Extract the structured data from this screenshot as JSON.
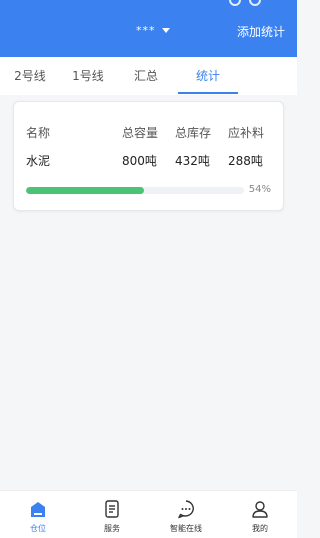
{
  "header": {
    "title": "***",
    "add_label": "添加统计"
  },
  "tabs": [
    {
      "label": "2号线"
    },
    {
      "label": "1号线"
    },
    {
      "label": "汇总"
    },
    {
      "label": "统计",
      "active": true
    }
  ],
  "card": {
    "columns": [
      "名称",
      "总容量",
      "总库存",
      "应补料"
    ],
    "row": {
      "name": "水泥",
      "capacity": "800吨",
      "stock": "432吨",
      "replenish": "288吨"
    },
    "progress": {
      "fraction": 0.54,
      "label": "54%"
    }
  },
  "bottom_nav": [
    {
      "label": "仓位",
      "icon": "warehouse-icon",
      "active": true
    },
    {
      "label": "服务",
      "icon": "document-icon"
    },
    {
      "label": "智能在线",
      "icon": "chat-icon"
    },
    {
      "label": "我的",
      "icon": "user-icon"
    }
  ],
  "colors": {
    "primary": "#3b82f0",
    "progress": "#4cc374",
    "background": "#f5f6f8"
  }
}
